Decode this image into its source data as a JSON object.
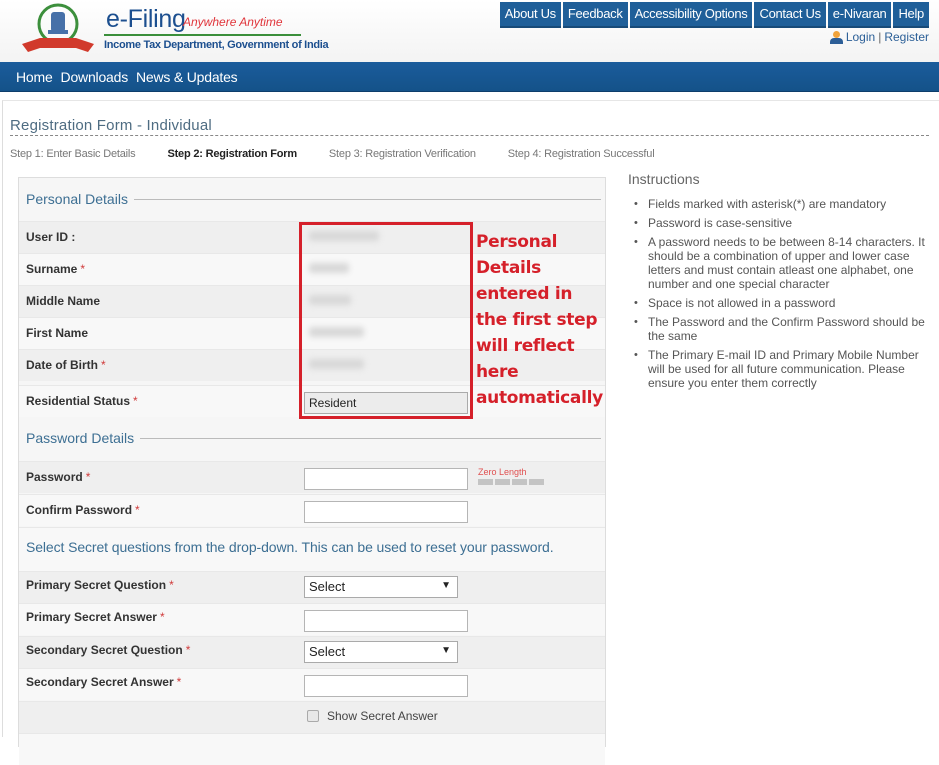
{
  "header": {
    "brand_title": "e-Filing",
    "brand_tagline": "Anywhere Anytime",
    "brand_subtitle": "Income Tax Department, Government of India",
    "top_nav": [
      "About Us",
      "Feedback",
      "Accessibility Options",
      "Contact Us",
      "e-Nivaran",
      "Help"
    ],
    "login_label": "Login",
    "login_separator": "|",
    "register_label": "Register"
  },
  "main_nav": [
    "Home",
    "Downloads",
    "News & Updates"
  ],
  "page": {
    "title": "Registration Form - Individual",
    "steps": [
      {
        "label": "Step 1: Enter Basic Details",
        "active": false
      },
      {
        "label": "Step 2: Registration Form",
        "active": true
      },
      {
        "label": "Step 3: Registration Verification",
        "active": false
      },
      {
        "label": "Step 4: Registration Successful",
        "active": false
      }
    ]
  },
  "personal_details": {
    "heading": "Personal Details",
    "fields": [
      {
        "label": "User ID :",
        "required": false,
        "value": "[blurred]"
      },
      {
        "label": "Surname",
        "required": true,
        "value": "[blurred]"
      },
      {
        "label": "Middle Name",
        "required": false,
        "value": "[blurred]"
      },
      {
        "label": "First Name",
        "required": false,
        "value": "[blurred]"
      },
      {
        "label": "Date of Birth",
        "required": true,
        "value": "[blurred]"
      },
      {
        "label": "Residential Status",
        "required": true,
        "value": "Resident"
      }
    ],
    "required_marker": "*"
  },
  "password_details": {
    "heading": "Password Details",
    "password_label": "Password",
    "password_value": "",
    "strength_text": "Zero Length",
    "strength_level": 0,
    "confirm_label": "Confirm Password",
    "confirm_value": ""
  },
  "secret_questions": {
    "note": "Select Secret questions from the drop-down. This can be used to reset your password.",
    "primary_question_label": "Primary Secret Question",
    "primary_question_value": "Select",
    "primary_answer_label": "Primary Secret Answer",
    "primary_answer_value": "",
    "secondary_question_label": "Secondary Secret Question",
    "secondary_question_value": "Select",
    "secondary_answer_label": "Secondary Secret Answer",
    "secondary_answer_value": "",
    "show_answer_label": "Show Secret Answer",
    "show_answer_checked": false
  },
  "annotation": {
    "text": "Personal Details entered in the first step will reflect here automatically",
    "color": "#d5202a"
  },
  "instructions": {
    "heading": "Instructions",
    "items": [
      "Fields marked with asterisk(*) are mandatory",
      "Password is case-sensitive",
      "A password needs to be between 8-14 characters. It should be a combination of upper and lower case letters and must contain atleast one alphabet, one number and one special character",
      "Space is not allowed in a password",
      "The Password and the Confirm Password should be the same",
      "The Primary E-mail ID and Primary Mobile Number will be used for all future communication. Please ensure you enter them correctly"
    ]
  },
  "colors": {
    "brand_blue": "#1f5f99",
    "section_heading": "#3d6f93",
    "required_star": "#d03a3a"
  }
}
